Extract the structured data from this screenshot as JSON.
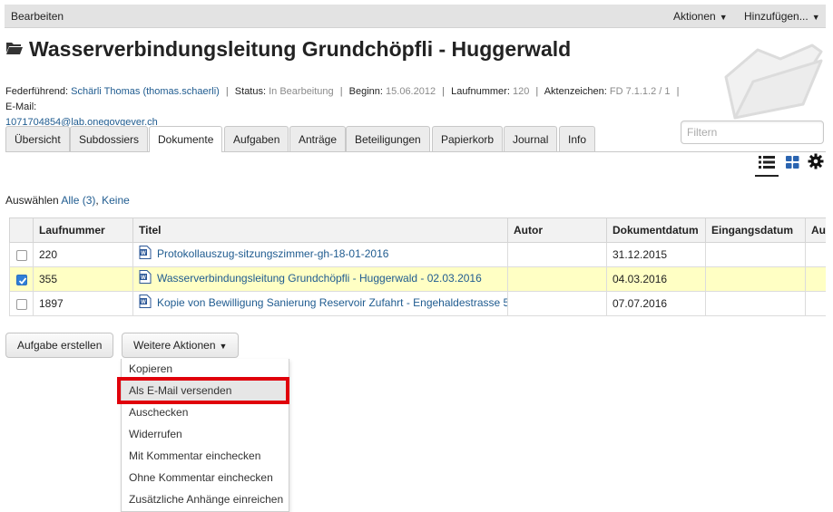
{
  "toolbar": {
    "edit_label": "Bearbeiten",
    "actions_label": "Aktionen",
    "add_label": "Hinzufügen..."
  },
  "page": {
    "title": "Wasserverbindungsleitung Grundchöpfli - Huggerwald"
  },
  "meta": {
    "lead_label": "Federführend:",
    "lead_value": "Schärli Thomas (thomas.schaerli)",
    "status_label": "Status:",
    "status_value": "In Bearbeitung",
    "begin_label": "Beginn:",
    "begin_value": "15.06.2012",
    "number_label": "Laufnummer:",
    "number_value": "120",
    "reference_label": "Aktenzeichen:",
    "reference_value": "FD 7.1.1.2 / 1",
    "email_label": "E-Mail:",
    "email_value": "1071704854@lab.onegovgever.ch"
  },
  "filter": {
    "placeholder": "Filtern"
  },
  "tabs": [
    {
      "label": "Übersicht"
    },
    {
      "label": "Subdossiers"
    },
    {
      "label": "Dokumente"
    },
    {
      "label": "Aufgaben"
    },
    {
      "label": "Anträge"
    },
    {
      "label": "Beteiligungen"
    },
    {
      "label": "Papierkorb"
    },
    {
      "label": "Journal"
    },
    {
      "label": "Info"
    }
  ],
  "active_tab": "Dokumente",
  "selection": {
    "prefix": "Auswählen",
    "all": "Alle (3)",
    "separator": ",",
    "none": "Keine"
  },
  "table": {
    "columns": [
      "Laufnummer",
      "Titel",
      "Autor",
      "Dokumentdatum",
      "Eingangsdatum",
      "Au"
    ],
    "rows": [
      {
        "checked": false,
        "number": "220",
        "title": "Protokollauszug-sitzungszimmer-gh-18-01-2016",
        "author": "",
        "doc_date": "31.12.2015",
        "in_date": ""
      },
      {
        "checked": true,
        "number": "355",
        "title": "Wasserverbindungsleitung Grundchöpfli - Huggerwald - 02.03.2016",
        "author": "",
        "doc_date": "04.03.2016",
        "in_date": ""
      },
      {
        "checked": false,
        "number": "1897",
        "title": "Kopie von Bewilligung Sanierung Reservoir Zufahrt - Engehaldestrasse 5",
        "author": "",
        "doc_date": "07.07.2016",
        "in_date": ""
      }
    ]
  },
  "buttons": {
    "create_task": "Aufgabe erstellen",
    "more_actions": "Weitere Aktionen"
  },
  "menu": {
    "items": [
      {
        "label": "Kopieren"
      },
      {
        "label": "Als E-Mail versenden"
      },
      {
        "label": "Auschecken"
      },
      {
        "label": "Widerrufen"
      },
      {
        "label": "Mit Kommentar einchecken"
      },
      {
        "label": "Ohne Kommentar einchecken"
      },
      {
        "label": "Zusätzliche Anhänge einreichen"
      }
    ],
    "highlighted": "Als E-Mail versenden"
  },
  "colors": {
    "link": "#205c90",
    "selected_row": "#ffffc4",
    "highlight_border": "#e0000b",
    "checkbox_checked": "#2f7fd7"
  },
  "icons": [
    "folder-icon",
    "large-folder-icon",
    "word-document-icon",
    "list-view-icon",
    "grid-view-icon",
    "gear-icon",
    "checkmark-icon"
  ]
}
